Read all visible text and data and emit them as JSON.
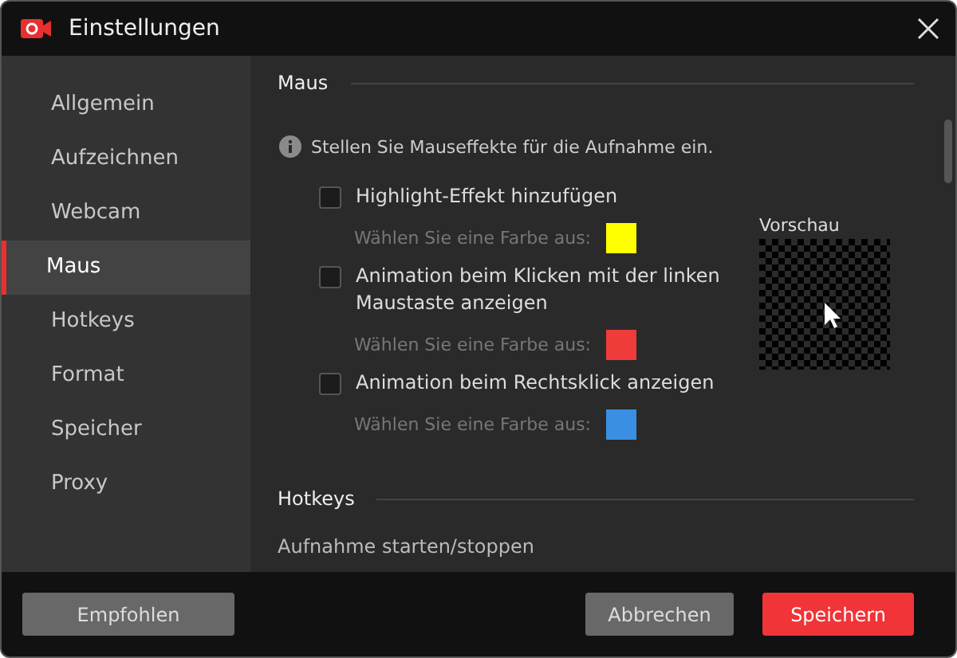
{
  "window": {
    "title": "Einstellungen"
  },
  "sidebar": {
    "items": [
      {
        "label": "Allgemein",
        "selected": false
      },
      {
        "label": "Aufzeichnen",
        "selected": false
      },
      {
        "label": "Webcam",
        "selected": false
      },
      {
        "label": "Maus",
        "selected": true
      },
      {
        "label": "Hotkeys",
        "selected": false
      },
      {
        "label": "Format",
        "selected": false
      },
      {
        "label": "Speicher",
        "selected": false
      },
      {
        "label": "Proxy",
        "selected": false
      }
    ]
  },
  "mouse_section": {
    "heading": "Maus",
    "info": "Stellen Sie Mauseffekte für die Aufnahme ein.",
    "options": [
      {
        "label": "Highlight-Effekt hinzufügen",
        "checked": false,
        "color_label": "Wählen Sie eine Farbe aus:",
        "color": "#ffff00"
      },
      {
        "label": "Animation beim Klicken mit der linken Maustaste anzeigen",
        "checked": false,
        "color_label": "Wählen Sie eine Farbe aus:",
        "color": "#f03b3b"
      },
      {
        "label": "Animation beim Rechtsklick anzeigen",
        "checked": false,
        "color_label": "Wählen Sie eine Farbe aus:",
        "color": "#3a8fe3"
      }
    ],
    "preview": {
      "label": "Vorschau"
    }
  },
  "hotkeys_section": {
    "heading": "Hotkeys",
    "items": [
      "Aufnahme starten/stoppen"
    ]
  },
  "buttons": [
    {
      "label": "Empfohlen",
      "kind": "secondary"
    },
    {
      "label": "Abbrechen",
      "kind": "secondary"
    },
    {
      "label": "Speichern",
      "kind": "primary"
    }
  ]
}
